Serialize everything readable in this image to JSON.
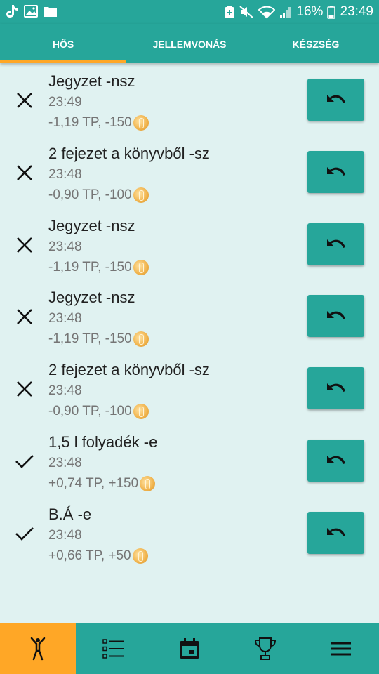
{
  "status_bar": {
    "battery_percent": "16%",
    "time": "23:49",
    "left_icons": [
      "tiktok-icon",
      "image-icon",
      "folder-icon"
    ],
    "right_icons": [
      "battery-saver-icon",
      "mute-icon",
      "wifi-icon",
      "signal-icon",
      "battery-icon"
    ]
  },
  "tabs": [
    {
      "label": "HŐS",
      "active": true
    },
    {
      "label": "JELLEMVONÁS",
      "active": false
    },
    {
      "label": "KÉSZSÉG",
      "active": false
    }
  ],
  "entries": [
    {
      "title": "Jegyzet -nsz",
      "time": "23:49",
      "delta": "-1,19 TP, -150",
      "status": "failed",
      "status_icon": "cross-icon",
      "action_icon": "undo-icon"
    },
    {
      "title": "2 fejezet a könyvből -sz",
      "time": "23:48",
      "delta": "-0,90 TP, -100",
      "status": "failed",
      "status_icon": "cross-icon",
      "action_icon": "undo-icon"
    },
    {
      "title": "Jegyzet -nsz",
      "time": "23:48",
      "delta": "-1,19 TP, -150",
      "status": "failed",
      "status_icon": "cross-icon",
      "action_icon": "undo-icon"
    },
    {
      "title": "Jegyzet -nsz",
      "time": "23:48",
      "delta": "-1,19 TP, -150",
      "status": "failed",
      "status_icon": "cross-icon",
      "action_icon": "undo-icon"
    },
    {
      "title": "2 fejezet a könyvből -sz",
      "time": "23:48",
      "delta": "-0,90 TP, -100",
      "status": "failed",
      "status_icon": "cross-icon",
      "action_icon": "undo-icon"
    },
    {
      "title": "1,5 l folyadék -e",
      "time": "23:48",
      "delta": "+0,74 TP, +150",
      "status": "done",
      "status_icon": "check-icon",
      "action_icon": "undo-icon"
    },
    {
      "title": "B.Á -e",
      "time": "23:48",
      "delta": "+0,66 TP, +50",
      "status": "done",
      "status_icon": "check-icon",
      "action_icon": "undo-icon"
    }
  ],
  "bottom_nav": [
    {
      "icon": "hero-figure-icon",
      "active": true
    },
    {
      "icon": "checklist-icon",
      "active": false
    },
    {
      "icon": "calendar-icon",
      "active": false
    },
    {
      "icon": "trophy-icon",
      "active": false
    },
    {
      "icon": "menu-icon",
      "active": false
    }
  ],
  "colors": {
    "primary": "#26a69a",
    "accent": "#ffa726",
    "background": "#e0f2f1",
    "text": "#212121",
    "secondary_text": "#757575"
  }
}
